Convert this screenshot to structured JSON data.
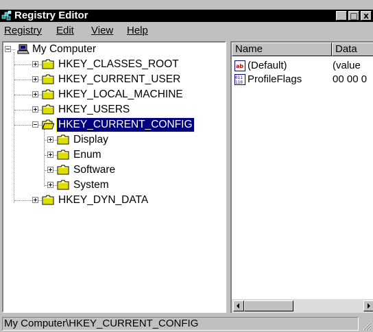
{
  "window": {
    "title": "Registry Editor",
    "buttons": {
      "minimize": "_",
      "maximize": "□",
      "close": "x"
    }
  },
  "menu": [
    "Registry",
    "Edit",
    "View",
    "Help"
  ],
  "tree": {
    "root": "My Computer",
    "hives": [
      {
        "label": "HKEY_CLASSES_ROOT",
        "expanded": false
      },
      {
        "label": "HKEY_CURRENT_USER",
        "expanded": false
      },
      {
        "label": "HKEY_LOCAL_MACHINE",
        "expanded": false
      },
      {
        "label": "HKEY_USERS",
        "expanded": false
      },
      {
        "label": "HKEY_CURRENT_CONFIG",
        "expanded": true,
        "selected": true,
        "children": [
          "Display",
          "Enum",
          "Software",
          "System"
        ]
      },
      {
        "label": "HKEY_DYN_DATA",
        "expanded": false
      }
    ]
  },
  "list": {
    "columns": [
      "Name",
      "Data"
    ],
    "rows": [
      {
        "name": "(Default)",
        "data": "(value",
        "icon": "string-value-icon"
      },
      {
        "name": "ProfileFlags",
        "data": "00 00 0",
        "icon": "binary-value-icon"
      }
    ]
  },
  "status": {
    "path": "My Computer\\HKEY_CURRENT_CONFIG"
  },
  "colors": {
    "selection": "#000080",
    "face": "#c0c0c0",
    "folder": "#ffff80"
  }
}
